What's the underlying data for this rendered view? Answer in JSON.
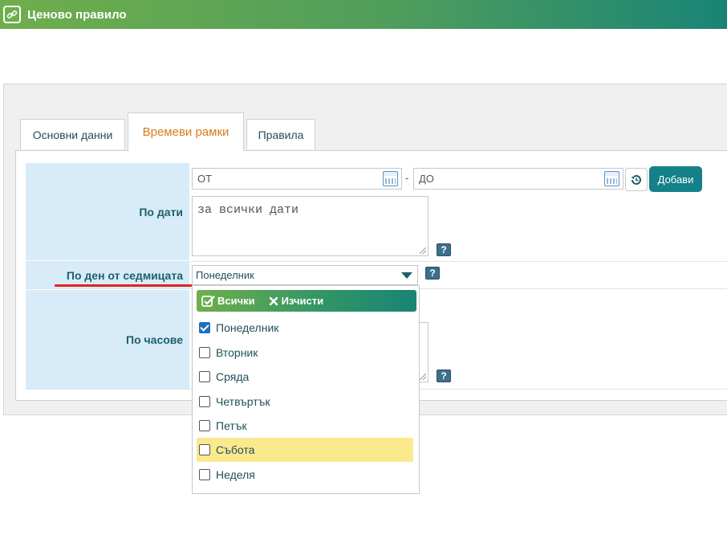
{
  "window": {
    "title": "Ценово правило",
    "icon": "link-icon"
  },
  "tabs": [
    {
      "label": "Основни данни",
      "active": false
    },
    {
      "label": "Времеви рамки",
      "active": true
    },
    {
      "label": "Правила",
      "active": false
    }
  ],
  "form": {
    "by_dates": {
      "label": "По дати",
      "from_placeholder": "ОТ",
      "separator": "-",
      "to_placeholder": "ДО",
      "add_button": "Добави",
      "textarea_value": "за всички дати",
      "help": "?"
    },
    "by_weekday": {
      "label": "По ден от седмицата",
      "selected": "Понеделник",
      "help": "?"
    },
    "by_hours": {
      "label": "По часове",
      "help": "?"
    }
  },
  "dropdown": {
    "select_all": "Всички",
    "clear": "Изчисти",
    "options": [
      {
        "label": "Понеделник",
        "checked": true,
        "highlighted": false
      },
      {
        "label": "Вторник",
        "checked": false,
        "highlighted": false
      },
      {
        "label": "Сряда",
        "checked": false,
        "highlighted": false
      },
      {
        "label": "Четвъртък",
        "checked": false,
        "highlighted": false
      },
      {
        "label": "Петък",
        "checked": false,
        "highlighted": false
      },
      {
        "label": "Събота",
        "checked": false,
        "highlighted": true
      },
      {
        "label": "Неделя",
        "checked": false,
        "highlighted": false
      }
    ]
  },
  "colors": {
    "accent": "#14808a",
    "tab_active": "#d97a1e",
    "label_bg": "#d7ebf9",
    "highlight": "#fbe98e",
    "annotation": "#e0231f"
  }
}
